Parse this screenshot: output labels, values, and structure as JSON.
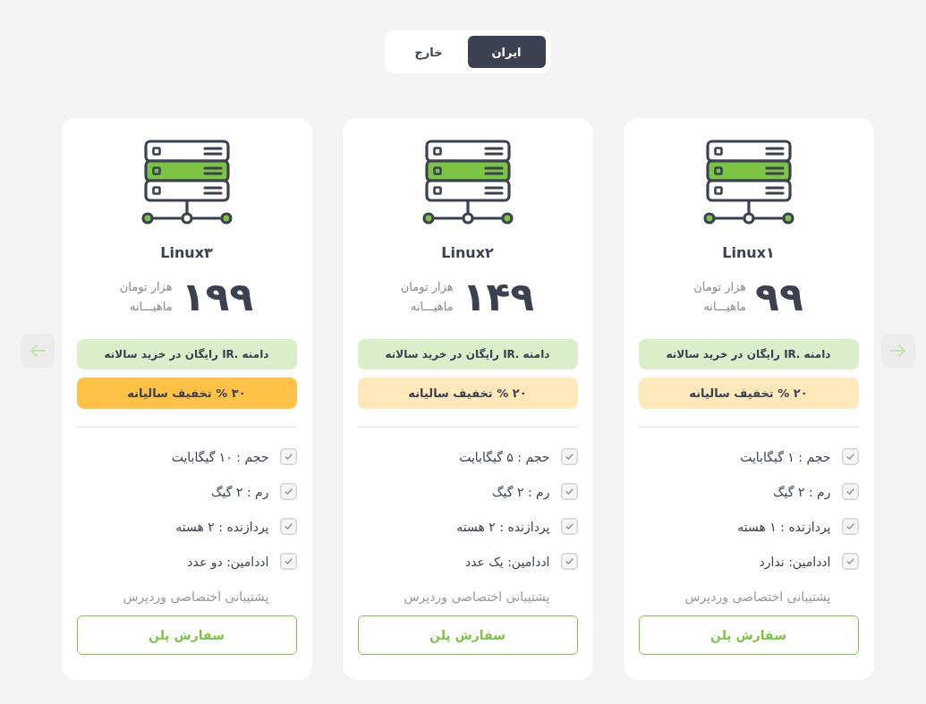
{
  "region_toggle": {
    "options": [
      {
        "label": "ایران",
        "selected": true
      },
      {
        "label": "خارج",
        "selected": false
      }
    ]
  },
  "plans": [
    {
      "name": "Linux۱",
      "price": "۹۹",
      "unit": "هزار تومان",
      "period": "ماهیـــانه",
      "domain_offer": "دامنه .IR رایگان در خرید سالانه",
      "discount": {
        "label": "۲۰ % تخفیف سالیانه",
        "highlight": false
      },
      "features": [
        {
          "text": "حجم : ۱ گیگابایت",
          "included": true
        },
        {
          "text": "رم : ۲ گیگ",
          "included": true
        },
        {
          "text": "پردازنده : ۱ هسته",
          "included": true
        },
        {
          "text": "اددامین: ندارد",
          "included": true
        },
        {
          "text": "پشتیبانی اختصاصی وردپرس",
          "included": false
        }
      ],
      "order_button": "سفارش پلن"
    },
    {
      "name": "Linux۲",
      "price": "۱۴۹",
      "unit": "هزار تومان",
      "period": "ماهیـــانه",
      "domain_offer": "دامنه .IR رایگان در خرید سالانه",
      "discount": {
        "label": "۲۰ % تخفیف سالیانه",
        "highlight": false
      },
      "features": [
        {
          "text": "حجم : ۵ گیگابایت",
          "included": true
        },
        {
          "text": "رم : ۲ گیگ",
          "included": true
        },
        {
          "text": "پردازنده : ۲ هسته",
          "included": true
        },
        {
          "text": "اددامین: یک عدد",
          "included": true
        },
        {
          "text": "پشتیبانی اختصاصی وردپرس",
          "included": false
        }
      ],
      "order_button": "سفارش پلن"
    },
    {
      "name": "Linux۳",
      "price": "۱۹۹",
      "unit": "هزار تومان",
      "period": "ماهیـــانه",
      "domain_offer": "دامنه .IR رایگان در خرید سالانه",
      "discount": {
        "label": "۳۰ % تخفیف سالیانه",
        "highlight": true
      },
      "features": [
        {
          "text": "حجم : ۱۰ گیگابایت",
          "included": true
        },
        {
          "text": "رم : ۲ گیگ",
          "included": true
        },
        {
          "text": "پردازنده : ۲ هسته",
          "included": true
        },
        {
          "text": "اددامین: دو عدد",
          "included": true
        },
        {
          "text": "پشتیبانی اختصاصی وردپرس",
          "included": false
        }
      ],
      "order_button": "سفارش پلن"
    }
  ]
}
